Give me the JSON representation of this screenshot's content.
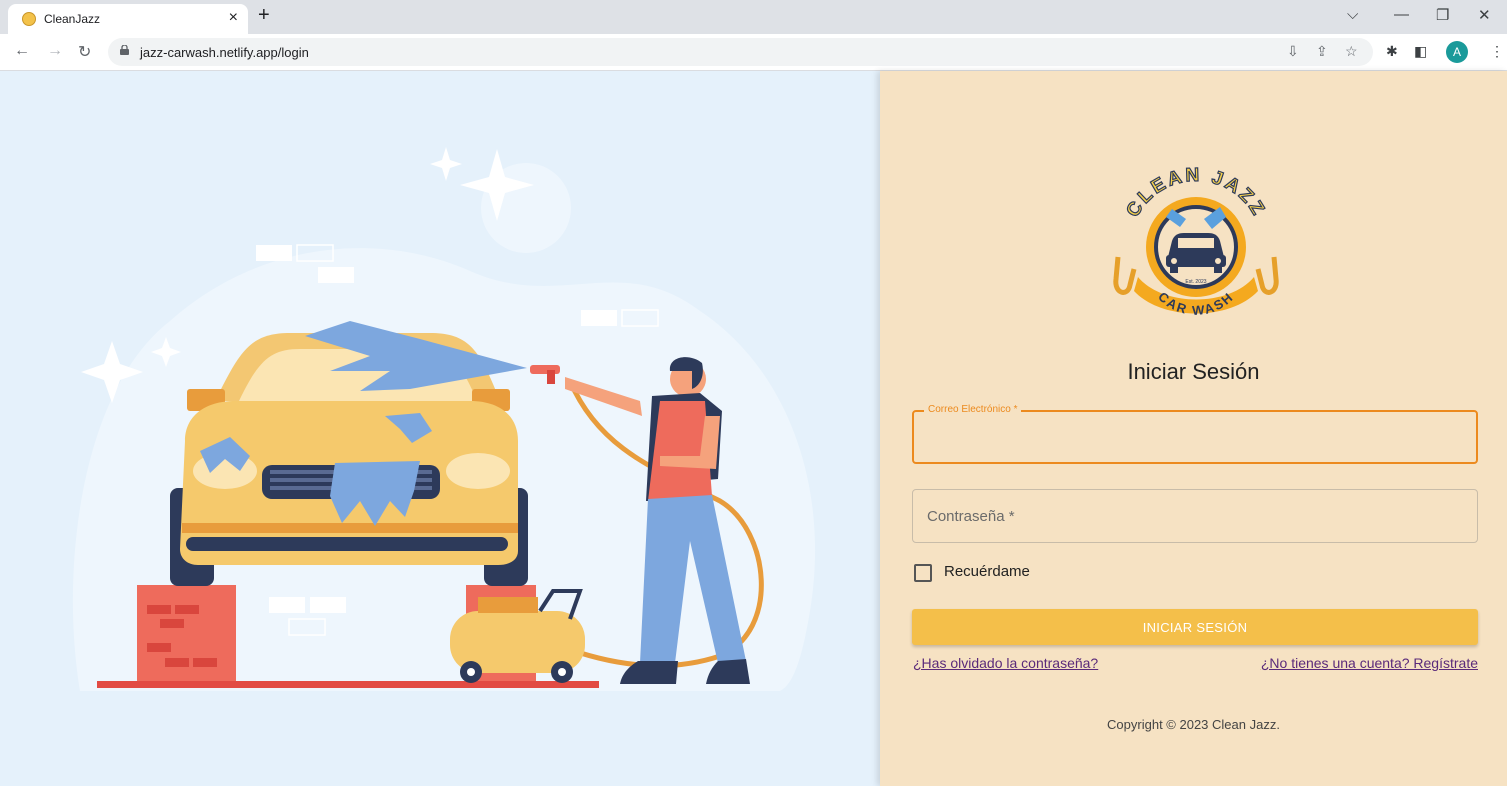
{
  "browser": {
    "tab_title": "CleanJazz",
    "tab_close": "×",
    "new_tab": "+",
    "url": "jazz-carwash.netlify.app/login",
    "profile_initial": "A"
  },
  "logo": {
    "top_text": "CLEAN JAZZ",
    "bottom_text": "CAR WASH",
    "established": "Est. 2023"
  },
  "form": {
    "title": "Iniciar Sesión",
    "email_label": "Correo Electrónico *",
    "email_value": "",
    "password_placeholder": "Contraseña *",
    "password_value": "",
    "remember_label": "Recuérdame",
    "remember_checked": false,
    "submit_label": "INICIAR SESIÓN",
    "forgot_link": "¿Has olvidado la contraseña?",
    "register_link": "¿No tienes una cuenta? Regístrate"
  },
  "footer": {
    "copyright": "Copyright © 2023 Clean Jazz."
  },
  "colors": {
    "left_bg": "#e5f1fb",
    "right_bg": "#f6e2c3",
    "accent_orange": "#ec8a1e",
    "button_yellow": "#f4bf4a",
    "link_purple": "#5a2a7a"
  }
}
